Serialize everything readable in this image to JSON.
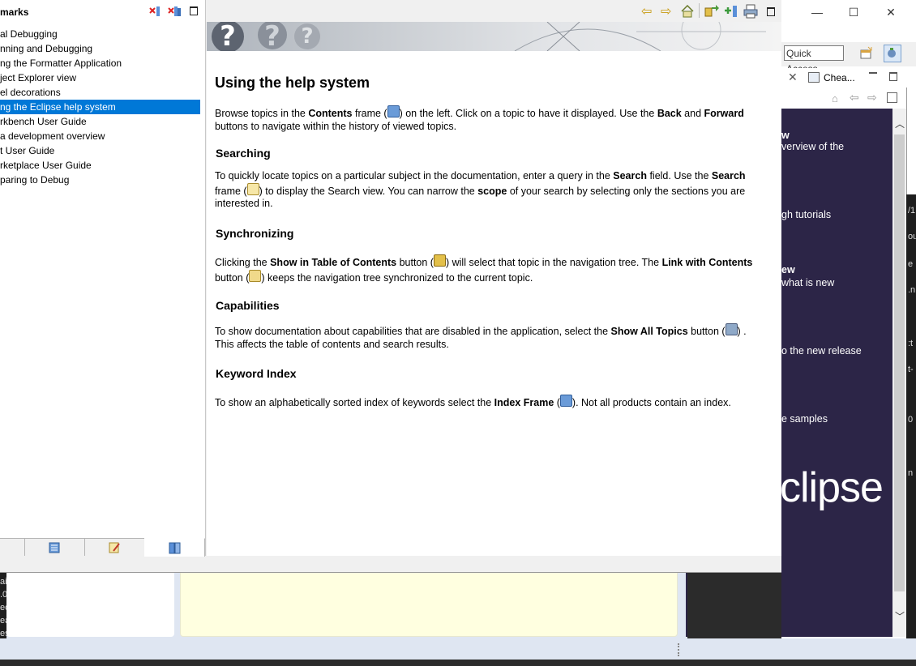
{
  "background": {
    "window_controls": [
      "—",
      "☐",
      "✕"
    ],
    "quick_access": "Quick Access",
    "tab_label": "Chea...",
    "welcome_lines": [
      {
        "text": "w",
        "bold": true
      },
      {
        "text": "verview of the",
        "bold": false
      },
      {
        "text": "gh tutorials",
        "bold": false
      },
      {
        "text": "ew",
        "bold": true
      },
      {
        "text": "what is new",
        "bold": false
      },
      {
        "text": "o the new release",
        "bold": false
      },
      {
        "text": "e samples",
        "bold": false
      }
    ],
    "eclipse_word": "clipse",
    "console_chars": [
      "ai",
      ".0",
      "ec",
      "ea",
      "es"
    ],
    "right_chars": [
      "/1",
      "ou",
      "e",
      ".n",
      ":t",
      "t-",
      "0",
      "n"
    ]
  },
  "left_panel": {
    "title": "marks",
    "toc": [
      {
        "label": "al Debugging",
        "selected": false
      },
      {
        "label": "nning and Debugging",
        "selected": false
      },
      {
        "label": "ng the Formatter Application",
        "selected": false
      },
      {
        "label": "ject Explorer view",
        "selected": false
      },
      {
        "label": "el decorations",
        "selected": false
      },
      {
        "label": "ng the Eclipse help system",
        "selected": true
      },
      {
        "label": "rkbench User Guide",
        "selected": false
      },
      {
        "label": "a development overview",
        "selected": false
      },
      {
        "label": "t User Guide",
        "selected": false
      },
      {
        "label": "rketplace User Guide",
        "selected": false
      },
      {
        "label": "paring to Debug",
        "selected": false
      }
    ]
  },
  "help_content": {
    "title": "Using the help system",
    "p1": {
      "a": "Browse topics in the ",
      "b": "Contents",
      "c": " frame (",
      "d": ") on the left. Click on a topic to have it displayed. Use the ",
      "e": "Back",
      "f": " and ",
      "g": "Forward",
      "h": " buttons to navigate within the history of viewed topics."
    },
    "h_search": "Searching",
    "p2": {
      "a": "To quickly locate topics on a particular subject in the documentation, enter a query in the ",
      "b": "Search",
      "c": " field. Use the ",
      "d": "Search",
      "e": " frame (",
      "f": ") to display the Search view. You can narrow the ",
      "g": "scope",
      "h": " of your search by selecting only the sections you are interested in."
    },
    "h_sync": "Synchronizing",
    "p3": {
      "a": "Clicking the ",
      "b": "Show in Table of Contents",
      "c": " button (",
      "d": ") will select that topic in the navigation tree. The ",
      "e": "Link with Contents",
      "f": " button (",
      "g": ") keeps the navigation tree synchronized to the current topic."
    },
    "h_cap": "Capabilities",
    "p4": {
      "a": "To show documentation about capabilities that are disabled in the application, select the ",
      "b": "Show All Topics",
      "c": " button (",
      "d": ") . This affects the table of contents and search results."
    },
    "h_kw": "Keyword Index",
    "p5": {
      "a": "To show an alphabetically sorted index of keywords select the ",
      "b": "Index Frame",
      "c": " (",
      "d": "). Not all products contain an index."
    }
  },
  "icons": {
    "left_header": [
      "remove-bookmark-icon",
      "remove-all-bookmarks-icon",
      "maximize-icon"
    ],
    "top_bar": [
      "back-icon",
      "forward-icon",
      "home-icon",
      "show-in-toc-icon",
      "bookmark-document-icon",
      "print-icon",
      "maximize-icon"
    ],
    "left_tabs": [
      "index-tab-icon",
      "search-tab-icon",
      "contents-tab-icon"
    ]
  },
  "colors": {
    "selection": "#0078d7",
    "welcome_bg": "#2c2547",
    "yellow_panel": "#ffffe0",
    "status_bar": "#dfe6f2"
  }
}
